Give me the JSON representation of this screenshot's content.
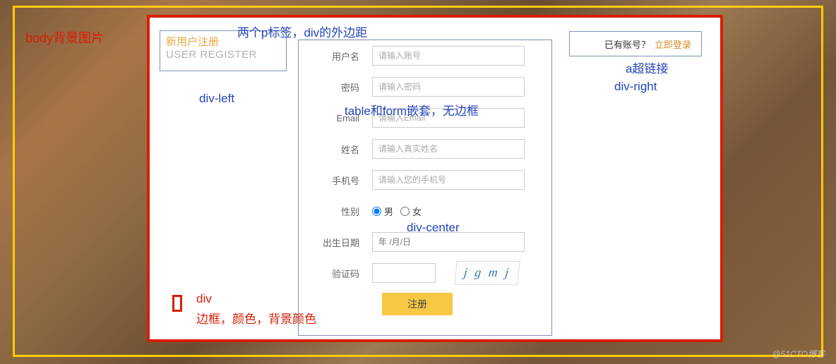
{
  "annotations": {
    "body_bg": "body背景图片",
    "p_margin": "两个p标签，div的外边距",
    "div_left": "div-left",
    "table_form": "table和form嵌套，无边框",
    "div_center": "div-center",
    "a_link": "a超链接",
    "div_right": "div-right",
    "div": "div",
    "border_color": "边框，颜色，背景颜色"
  },
  "left_panel": {
    "cn_title": "新用户注册",
    "en_title": "USER REGISTER"
  },
  "right_panel": {
    "prompt": "已有账号？",
    "login_text": "立即登录"
  },
  "form": {
    "username": {
      "label": "用户名",
      "placeholder": "请输入账号"
    },
    "password": {
      "label": "密码",
      "placeholder": "请输入密码"
    },
    "email": {
      "label": "Email",
      "placeholder": "请输入Email"
    },
    "realname": {
      "label": "姓名",
      "placeholder": "请输入真实姓名"
    },
    "phone": {
      "label": "手机号",
      "placeholder": "请输入您的手机号"
    },
    "gender": {
      "label": "性别",
      "male": "男",
      "female": "女"
    },
    "birthday": {
      "label": "出生日期",
      "placeholder": "年 /月/日"
    },
    "captcha": {
      "label": "验证码",
      "img_text": "j g m j"
    },
    "submit": "注册"
  },
  "watermark": "@51CTO博客"
}
